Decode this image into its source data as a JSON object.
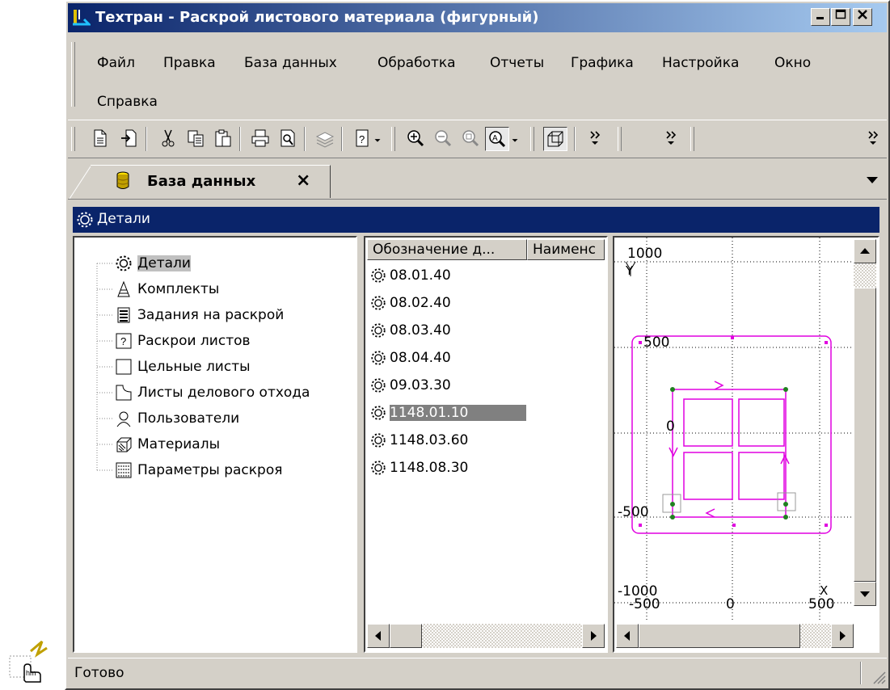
{
  "window": {
    "title": "Техтран - Раскрой листового материала (фигурный)"
  },
  "menu": [
    "Файл",
    "Правка",
    "База данных",
    "Обработка",
    "Отчеты",
    "Графика",
    "Настройка",
    "Окно",
    "Справка"
  ],
  "tab": {
    "label": "База данных",
    "close": "×"
  },
  "panel": {
    "title": "Детали"
  },
  "tree": [
    {
      "label": "Детали",
      "icon": "gear-icon",
      "selected": true
    },
    {
      "label": "Комплекты",
      "icon": "stack-icon"
    },
    {
      "label": "Задания на раскрой",
      "icon": "task-icon"
    },
    {
      "label": "Раскрои листов",
      "icon": "question-sheet-icon"
    },
    {
      "label": "Цельные листы",
      "icon": "sheet-icon"
    },
    {
      "label": "Листы делового отхода",
      "icon": "offcut-sheet-icon"
    },
    {
      "label": "Пользователи",
      "icon": "user-icon"
    },
    {
      "label": "Материалы",
      "icon": "material-icon"
    },
    {
      "label": "Параметры раскроя",
      "icon": "params-icon"
    }
  ],
  "list": {
    "columns": [
      "Обозначение д...",
      "Наименс"
    ],
    "rows": [
      "08.01.40",
      "08.02.40",
      "08.03.40",
      "08.04.40",
      "09.03.30",
      "1148.01.10",
      "1148.03.60",
      "1148.08.30"
    ],
    "selected_row": "1148.01.10"
  },
  "preview": {
    "y_labels": [
      "1000",
      "500",
      "0",
      "-500",
      "-1000"
    ],
    "x_labels": [
      "-500",
      "0",
      "500"
    ],
    "y_axis_label": "Y",
    "x_axis_label": "X",
    "part_color": "#e000e0",
    "node_color": "#208020"
  },
  "status": {
    "text": "Готово"
  },
  "colors": {
    "titlebar": "#0a246a",
    "face": "#d4d0c8",
    "selection": "#808080"
  }
}
